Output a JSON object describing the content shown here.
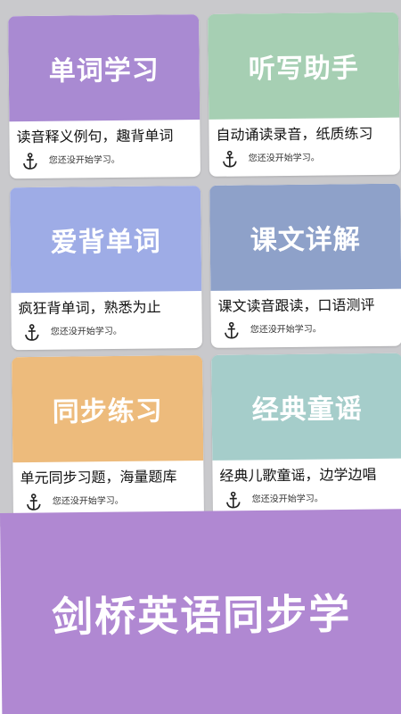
{
  "cards": [
    {
      "title": "单词学习",
      "desc": "读音释义例句，趣背单词",
      "status": "您还没开始学习。",
      "color": "#a98ad2"
    },
    {
      "title": "听写助手",
      "desc": "自动诵读录音，纸质练习",
      "status": "您还没开始学习。",
      "color": "#a6cfb3"
    },
    {
      "title": "爱背单词",
      "desc": "疯狂背单词，熟悉为止",
      "status": "您还没开始学习。",
      "color": "#9eace6"
    },
    {
      "title": "课文详解",
      "desc": "课文读音跟读，口语测评",
      "status": "您还没开始学习。",
      "color": "#8ea1c9"
    },
    {
      "title": "同步练习",
      "desc": "单元同步习题，海量题库",
      "status": "您还没开始学习。",
      "color": "#edbb7c"
    },
    {
      "title": "经典童谣",
      "desc": "经典儿歌童谣，边学边唱",
      "status": "您还没开始学习。",
      "color": "#a5cdca"
    }
  ],
  "icons": {
    "status": "anchor-icon"
  },
  "footer": {
    "title": "剑桥英语同步学",
    "color": "#b088d2"
  }
}
